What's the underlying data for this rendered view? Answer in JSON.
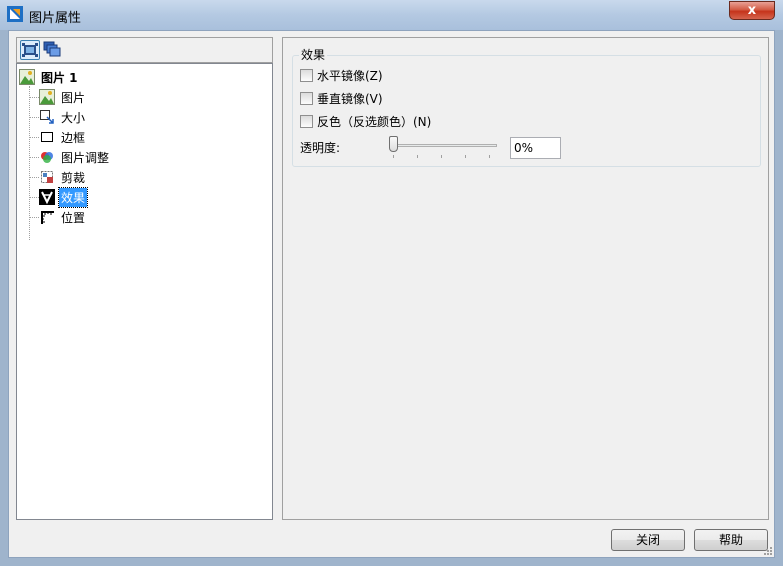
{
  "window": {
    "title": "图片属性",
    "close_glyph": "x"
  },
  "toolbar": {
    "buttons": [
      {
        "icon": "picture-frame-icon",
        "active": true
      },
      {
        "icon": "layers-icon",
        "active": false
      }
    ]
  },
  "tree": {
    "root": {
      "label": "图片 1",
      "icon": "picture-icon"
    },
    "items": [
      {
        "label": "图片",
        "icon": "picture-icon"
      },
      {
        "label": "大小",
        "icon": "resize-icon"
      },
      {
        "label": "边框",
        "icon": "border-icon"
      },
      {
        "label": "图片调整",
        "icon": "color-adjust-icon"
      },
      {
        "label": "剪裁",
        "icon": "crop-icon"
      },
      {
        "label": "效果",
        "icon": "effects-icon",
        "selected": true
      },
      {
        "label": "位置",
        "icon": "position-icon"
      }
    ]
  },
  "effects": {
    "group_title": "效果",
    "horizontal_mirror": {
      "label": "水平镜像(Z)",
      "checked": false
    },
    "vertical_mirror": {
      "label": "垂直镜像(V)",
      "checked": false
    },
    "invert": {
      "label": "反色（反选颜色）(N)",
      "checked": false
    },
    "transparency": {
      "label": "透明度:",
      "value": "0%",
      "level": 0
    }
  },
  "buttons": {
    "close": "关闭",
    "help": "帮助"
  },
  "colors": {
    "selection": "#3399ff",
    "titlebar": "#b4c9e2",
    "close_red": "#c5341b"
  }
}
